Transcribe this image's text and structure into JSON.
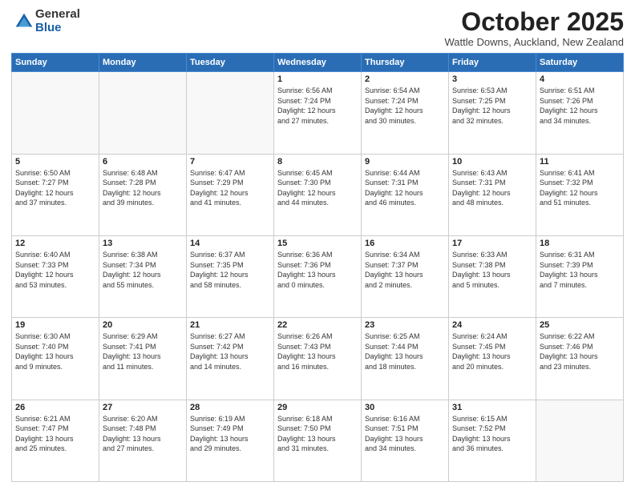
{
  "logo": {
    "general": "General",
    "blue": "Blue"
  },
  "header": {
    "month": "October 2025",
    "location": "Wattle Downs, Auckland, New Zealand"
  },
  "days_of_week": [
    "Sunday",
    "Monday",
    "Tuesday",
    "Wednesday",
    "Thursday",
    "Friday",
    "Saturday"
  ],
  "weeks": [
    [
      {
        "day": "",
        "info": ""
      },
      {
        "day": "",
        "info": ""
      },
      {
        "day": "",
        "info": ""
      },
      {
        "day": "1",
        "info": "Sunrise: 6:56 AM\nSunset: 7:24 PM\nDaylight: 12 hours\nand 27 minutes."
      },
      {
        "day": "2",
        "info": "Sunrise: 6:54 AM\nSunset: 7:24 PM\nDaylight: 12 hours\nand 30 minutes."
      },
      {
        "day": "3",
        "info": "Sunrise: 6:53 AM\nSunset: 7:25 PM\nDaylight: 12 hours\nand 32 minutes."
      },
      {
        "day": "4",
        "info": "Sunrise: 6:51 AM\nSunset: 7:26 PM\nDaylight: 12 hours\nand 34 minutes."
      }
    ],
    [
      {
        "day": "5",
        "info": "Sunrise: 6:50 AM\nSunset: 7:27 PM\nDaylight: 12 hours\nand 37 minutes."
      },
      {
        "day": "6",
        "info": "Sunrise: 6:48 AM\nSunset: 7:28 PM\nDaylight: 12 hours\nand 39 minutes."
      },
      {
        "day": "7",
        "info": "Sunrise: 6:47 AM\nSunset: 7:29 PM\nDaylight: 12 hours\nand 41 minutes."
      },
      {
        "day": "8",
        "info": "Sunrise: 6:45 AM\nSunset: 7:30 PM\nDaylight: 12 hours\nand 44 minutes."
      },
      {
        "day": "9",
        "info": "Sunrise: 6:44 AM\nSunset: 7:31 PM\nDaylight: 12 hours\nand 46 minutes."
      },
      {
        "day": "10",
        "info": "Sunrise: 6:43 AM\nSunset: 7:31 PM\nDaylight: 12 hours\nand 48 minutes."
      },
      {
        "day": "11",
        "info": "Sunrise: 6:41 AM\nSunset: 7:32 PM\nDaylight: 12 hours\nand 51 minutes."
      }
    ],
    [
      {
        "day": "12",
        "info": "Sunrise: 6:40 AM\nSunset: 7:33 PM\nDaylight: 12 hours\nand 53 minutes."
      },
      {
        "day": "13",
        "info": "Sunrise: 6:38 AM\nSunset: 7:34 PM\nDaylight: 12 hours\nand 55 minutes."
      },
      {
        "day": "14",
        "info": "Sunrise: 6:37 AM\nSunset: 7:35 PM\nDaylight: 12 hours\nand 58 minutes."
      },
      {
        "day": "15",
        "info": "Sunrise: 6:36 AM\nSunset: 7:36 PM\nDaylight: 13 hours\nand 0 minutes."
      },
      {
        "day": "16",
        "info": "Sunrise: 6:34 AM\nSunset: 7:37 PM\nDaylight: 13 hours\nand 2 minutes."
      },
      {
        "day": "17",
        "info": "Sunrise: 6:33 AM\nSunset: 7:38 PM\nDaylight: 13 hours\nand 5 minutes."
      },
      {
        "day": "18",
        "info": "Sunrise: 6:31 AM\nSunset: 7:39 PM\nDaylight: 13 hours\nand 7 minutes."
      }
    ],
    [
      {
        "day": "19",
        "info": "Sunrise: 6:30 AM\nSunset: 7:40 PM\nDaylight: 13 hours\nand 9 minutes."
      },
      {
        "day": "20",
        "info": "Sunrise: 6:29 AM\nSunset: 7:41 PM\nDaylight: 13 hours\nand 11 minutes."
      },
      {
        "day": "21",
        "info": "Sunrise: 6:27 AM\nSunset: 7:42 PM\nDaylight: 13 hours\nand 14 minutes."
      },
      {
        "day": "22",
        "info": "Sunrise: 6:26 AM\nSunset: 7:43 PM\nDaylight: 13 hours\nand 16 minutes."
      },
      {
        "day": "23",
        "info": "Sunrise: 6:25 AM\nSunset: 7:44 PM\nDaylight: 13 hours\nand 18 minutes."
      },
      {
        "day": "24",
        "info": "Sunrise: 6:24 AM\nSunset: 7:45 PM\nDaylight: 13 hours\nand 20 minutes."
      },
      {
        "day": "25",
        "info": "Sunrise: 6:22 AM\nSunset: 7:46 PM\nDaylight: 13 hours\nand 23 minutes."
      }
    ],
    [
      {
        "day": "26",
        "info": "Sunrise: 6:21 AM\nSunset: 7:47 PM\nDaylight: 13 hours\nand 25 minutes."
      },
      {
        "day": "27",
        "info": "Sunrise: 6:20 AM\nSunset: 7:48 PM\nDaylight: 13 hours\nand 27 minutes."
      },
      {
        "day": "28",
        "info": "Sunrise: 6:19 AM\nSunset: 7:49 PM\nDaylight: 13 hours\nand 29 minutes."
      },
      {
        "day": "29",
        "info": "Sunrise: 6:18 AM\nSunset: 7:50 PM\nDaylight: 13 hours\nand 31 minutes."
      },
      {
        "day": "30",
        "info": "Sunrise: 6:16 AM\nSunset: 7:51 PM\nDaylight: 13 hours\nand 34 minutes."
      },
      {
        "day": "31",
        "info": "Sunrise: 6:15 AM\nSunset: 7:52 PM\nDaylight: 13 hours\nand 36 minutes."
      },
      {
        "day": "",
        "info": ""
      }
    ]
  ]
}
